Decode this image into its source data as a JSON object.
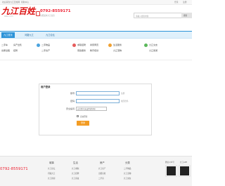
{
  "topbar": {
    "left_links": [
      "欢迎来到九江百姓网",
      "帮助中心"
    ],
    "right_links": [
      "登录",
      "注册"
    ]
  },
  "header": {
    "logo_text": "九江百姓",
    "logo_sub": "9zbx.com",
    "phone": "0792-8559171",
    "phone_sub": "免费发布九江信息",
    "search_placeholder": "请输入搜索内容",
    "search_button": "搜索"
  },
  "nav": {
    "items": [
      "九江首页",
      "问路九江",
      "九江论坛"
    ]
  },
  "categories": {
    "col1": [
      "二手车",
      "房产出售",
      "房屋出租",
      "招聘"
    ],
    "col2": [
      "二手物品",
      "二手房产"
    ],
    "col3": [
      "求职招聘",
      "商家黄页",
      "家政服务",
      "教育培训"
    ],
    "col4": [
      "生活服务",
      "九江宠物"
    ],
    "col5": [
      "九江交友",
      "九江旅游"
    ]
  },
  "login": {
    "title": "用户登录",
    "username_label": "账号:",
    "username_hint": "注册",
    "password_label": "密码:",
    "password_hint": "找回密码",
    "question_label": "安全提问:",
    "question_value": "安全提问(未设置请忽略)",
    "remember_label": "自动登录",
    "submit": "登录"
  },
  "footer": {
    "phone": "0792-8559171",
    "columns": [
      {
        "title": "城事",
        "links": [
          "九江论坛",
          "问路九江",
          "九江新闻"
        ]
      },
      {
        "title": "生活",
        "links": [
          "九江求职",
          "九江招聘",
          "九江家政"
        ]
      },
      {
        "title": "房产",
        "links": [
          "九江房产",
          "出租房屋",
          "二手房"
        ]
      },
      {
        "title": "分类",
        "links": [
          "二手物品",
          "九江宠物",
          "九江交友"
        ]
      }
    ],
    "qr_labels": [
      "微信公众号",
      "九江APP"
    ]
  }
}
